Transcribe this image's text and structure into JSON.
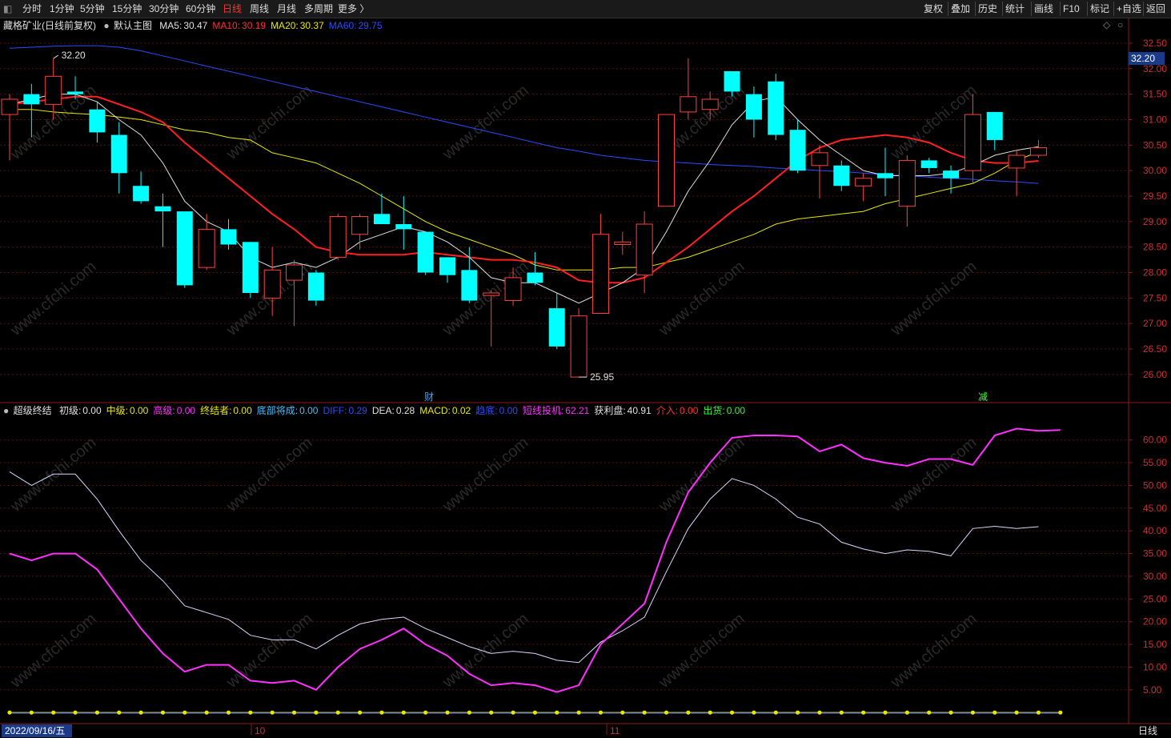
{
  "toolbar": {
    "periods": [
      "分时",
      "1分钟",
      "5分钟",
      "15分钟",
      "30分钟",
      "60分钟",
      "日线",
      "周线",
      "月线",
      "多周期",
      "更多 〉"
    ],
    "active_period": "日线",
    "right_buttons": [
      "复权",
      "叠加",
      "历史",
      "统计",
      "画线",
      "F10",
      "标记",
      "+自选",
      "返回"
    ]
  },
  "main_legend": {
    "name": "藏格矿业(日线前复权)",
    "indicator": "默认主图",
    "items": [
      {
        "label": "MA5:",
        "value": "30.47",
        "color": "#e0e0e0"
      },
      {
        "label": "MA10:",
        "value": "30.19",
        "color": "#ff3030"
      },
      {
        "label": "MA20:",
        "value": "30.37",
        "color": "#e8e800"
      },
      {
        "label": "MA60:",
        "value": "29.75",
        "color": "#2a4cff"
      }
    ]
  },
  "sub_legend": {
    "name": "超级终结",
    "items": [
      {
        "label": "初级:",
        "value": "0.00",
        "color": "#e0e0e0"
      },
      {
        "label": "中级:",
        "value": "0.00",
        "color": "#e8e800"
      },
      {
        "label": "高级:",
        "value": "0.00",
        "color": "#ff30ff"
      },
      {
        "label": "终结者:",
        "value": "0.00",
        "color": "#e8e800"
      },
      {
        "label": "底部将成:",
        "value": "0.00",
        "color": "#40c0ff"
      },
      {
        "label": "DIFF:",
        "value": "0.29",
        "color": "#2a4cff"
      },
      {
        "label": "DEA:",
        "value": "0.28",
        "color": "#e0e0e0"
      },
      {
        "label": "MACD:",
        "value": "0.02",
        "color": "#e8e800"
      },
      {
        "label": "趋底:",
        "value": "0.00",
        "color": "#2a4cff"
      },
      {
        "label": "短线投机:",
        "value": "62.21",
        "color": "#ff30ff"
      },
      {
        "label": "获利盘:",
        "value": "40.91",
        "color": "#e0e0e0"
      },
      {
        "label": "介入:",
        "value": "0.00",
        "color": "#ff3030"
      },
      {
        "label": "出货:",
        "value": "0.00",
        "color": "#30ff30"
      }
    ]
  },
  "price_axis": {
    "current_price": "32.20",
    "ticks": [
      "32.50",
      "32.00",
      "31.50",
      "31.00",
      "30.50",
      "30.00",
      "29.50",
      "29.00",
      "28.50",
      "28.00",
      "27.50",
      "27.00",
      "26.50",
      "26.00"
    ],
    "ymin": 25.7,
    "ymax": 32.75
  },
  "sub_axis": {
    "ticks": [
      "60.00",
      "55.00",
      "50.00",
      "45.00",
      "40.00",
      "35.00",
      "30.00",
      "25.00",
      "20.00",
      "15.00",
      "10.00",
      "5.00"
    ],
    "ymin": -0.5,
    "ymax": 64
  },
  "date_axis": {
    "labels": [
      "2022/09/16/五",
      "10",
      "11"
    ],
    "period": "日线"
  },
  "markers": {
    "high_label": "32.20",
    "low_label": "25.95",
    "event1": "财",
    "event2": "减"
  },
  "watermark": "www.cfchi.com",
  "chart_data": {
    "type": "candlestick",
    "series_candles": [
      {
        "o": 31.1,
        "h": 31.5,
        "l": 30.2,
        "c": 31.4
      },
      {
        "o": 31.5,
        "h": 31.7,
        "l": 30.65,
        "c": 31.3
      },
      {
        "o": 31.3,
        "h": 32.2,
        "l": 31.0,
        "c": 31.85
      },
      {
        "o": 31.55,
        "h": 31.85,
        "l": 31.4,
        "c": 31.5
      },
      {
        "o": 31.2,
        "h": 31.35,
        "l": 30.55,
        "c": 30.75
      },
      {
        "o": 30.7,
        "h": 30.95,
        "l": 29.55,
        "c": 29.95
      },
      {
        "o": 29.7,
        "h": 29.98,
        "l": 29.35,
        "c": 29.4
      },
      {
        "o": 29.3,
        "h": 29.55,
        "l": 28.5,
        "c": 29.2
      },
      {
        "o": 29.2,
        "h": 29.2,
        "l": 27.7,
        "c": 27.75
      },
      {
        "o": 28.1,
        "h": 29.15,
        "l": 28.05,
        "c": 28.85
      },
      {
        "o": 28.85,
        "h": 29.05,
        "l": 28.45,
        "c": 28.55
      },
      {
        "o": 28.6,
        "h": 28.6,
        "l": 27.5,
        "c": 27.6
      },
      {
        "o": 27.5,
        "h": 28.5,
        "l": 27.15,
        "c": 28.05
      },
      {
        "o": 27.85,
        "h": 28.25,
        "l": 26.95,
        "c": 28.15
      },
      {
        "o": 28.0,
        "h": 28.05,
        "l": 27.35,
        "c": 27.45
      },
      {
        "o": 28.3,
        "h": 29.15,
        "l": 28.25,
        "c": 29.1
      },
      {
        "o": 28.75,
        "h": 29.15,
        "l": 28.45,
        "c": 29.1
      },
      {
        "o": 29.15,
        "h": 29.55,
        "l": 28.95,
        "c": 28.95
      },
      {
        "o": 28.95,
        "h": 29.5,
        "l": 28.45,
        "c": 28.85
      },
      {
        "o": 28.8,
        "h": 28.8,
        "l": 27.95,
        "c": 28.0
      },
      {
        "o": 28.3,
        "h": 28.3,
        "l": 27.8,
        "c": 27.95
      },
      {
        "o": 28.05,
        "h": 28.5,
        "l": 27.4,
        "c": 27.45
      },
      {
        "o": 27.55,
        "h": 27.65,
        "l": 26.55,
        "c": 27.6
      },
      {
        "o": 27.45,
        "h": 28.1,
        "l": 27.35,
        "c": 27.9
      },
      {
        "o": 28.0,
        "h": 28.4,
        "l": 27.75,
        "c": 27.8
      },
      {
        "o": 27.3,
        "h": 27.6,
        "l": 26.5,
        "c": 26.55
      },
      {
        "o": 25.95,
        "h": 27.3,
        "l": 25.95,
        "c": 27.15
      },
      {
        "o": 27.2,
        "h": 29.15,
        "l": 27.2,
        "c": 28.75
      },
      {
        "o": 28.55,
        "h": 28.8,
        "l": 28.35,
        "c": 28.6
      },
      {
        "o": 27.95,
        "h": 29.2,
        "l": 27.6,
        "c": 28.95
      },
      {
        "o": 29.3,
        "h": 31.1,
        "l": 29.3,
        "c": 31.1
      },
      {
        "o": 31.15,
        "h": 32.2,
        "l": 31.0,
        "c": 31.45
      },
      {
        "o": 31.2,
        "h": 31.55,
        "l": 31.0,
        "c": 31.4
      },
      {
        "o": 31.95,
        "h": 31.95,
        "l": 31.45,
        "c": 31.55
      },
      {
        "o": 31.5,
        "h": 31.65,
        "l": 30.65,
        "c": 31.0
      },
      {
        "o": 31.75,
        "h": 31.9,
        "l": 30.6,
        "c": 30.7
      },
      {
        "o": 30.8,
        "h": 31.0,
        "l": 29.95,
        "c": 30.0
      },
      {
        "o": 30.1,
        "h": 30.5,
        "l": 29.45,
        "c": 30.35
      },
      {
        "o": 30.1,
        "h": 30.2,
        "l": 29.6,
        "c": 29.7
      },
      {
        "o": 29.7,
        "h": 29.95,
        "l": 29.4,
        "c": 29.85
      },
      {
        "o": 29.95,
        "h": 30.45,
        "l": 29.5,
        "c": 29.85
      },
      {
        "o": 29.3,
        "h": 30.3,
        "l": 28.9,
        "c": 30.2
      },
      {
        "o": 30.2,
        "h": 30.25,
        "l": 29.95,
        "c": 30.05
      },
      {
        "o": 30.0,
        "h": 30.1,
        "l": 29.55,
        "c": 29.85
      },
      {
        "o": 30.0,
        "h": 31.5,
        "l": 29.75,
        "c": 31.1
      },
      {
        "o": 31.15,
        "h": 31.15,
        "l": 30.4,
        "c": 30.6
      },
      {
        "o": 30.05,
        "h": 30.4,
        "l": 29.5,
        "c": 30.3
      },
      {
        "o": 30.3,
        "h": 30.6,
        "l": 30.25,
        "c": 30.45
      }
    ],
    "ma5": [
      31.3,
      31.4,
      31.5,
      31.5,
      31.35,
      31.0,
      30.7,
      30.15,
      29.4,
      29.0,
      28.8,
      28.3,
      28.1,
      28.2,
      28.1,
      28.3,
      28.6,
      28.75,
      28.9,
      28.8,
      28.6,
      28.3,
      27.9,
      27.8,
      27.8,
      27.6,
      27.4,
      27.6,
      27.8,
      28.1,
      28.8,
      29.6,
      30.2,
      30.9,
      31.35,
      31.45,
      31.0,
      30.6,
      30.3,
      30.0,
      29.9,
      29.9,
      29.9,
      29.95,
      30.1,
      30.3,
      30.4,
      30.47
    ],
    "ma10": [
      31.3,
      31.35,
      31.4,
      31.45,
      31.45,
      31.3,
      31.15,
      30.95,
      30.55,
      30.2,
      29.85,
      29.5,
      29.15,
      28.85,
      28.5,
      28.4,
      28.35,
      28.35,
      28.35,
      28.4,
      28.35,
      28.3,
      28.25,
      28.25,
      28.2,
      28.1,
      27.85,
      27.8,
      27.8,
      27.9,
      28.2,
      28.5,
      28.85,
      29.2,
      29.5,
      29.85,
      30.2,
      30.45,
      30.6,
      30.65,
      30.7,
      30.65,
      30.55,
      30.35,
      30.2,
      30.15,
      30.15,
      30.19
    ],
    "ma20": [
      31.2,
      31.2,
      31.15,
      31.12,
      31.1,
      31.05,
      31.0,
      30.9,
      30.8,
      30.75,
      30.65,
      30.6,
      30.35,
      30.25,
      30.15,
      29.95,
      29.75,
      29.5,
      29.25,
      29.0,
      28.8,
      28.65,
      28.5,
      28.35,
      28.15,
      28.05,
      28.05,
      28.05,
      28.1,
      28.1,
      28.2,
      28.3,
      28.45,
      28.6,
      28.75,
      28.95,
      29.05,
      29.1,
      29.15,
      29.2,
      29.35,
      29.45,
      29.55,
      29.65,
      29.75,
      29.95,
      30.2,
      30.37
    ],
    "ma60": [
      32.4,
      32.42,
      32.44,
      32.45,
      32.45,
      32.42,
      32.35,
      32.25,
      32.15,
      32.05,
      31.95,
      31.85,
      31.75,
      31.65,
      31.55,
      31.45,
      31.35,
      31.25,
      31.15,
      31.05,
      30.95,
      30.85,
      30.75,
      30.65,
      30.55,
      30.45,
      30.38,
      30.3,
      30.25,
      30.2,
      30.17,
      30.15,
      30.12,
      30.1,
      30.08,
      30.05,
      30.03,
      30.0,
      29.98,
      29.95,
      29.92,
      29.9,
      29.87,
      29.85,
      29.83,
      29.8,
      29.78,
      29.75
    ],
    "short_spec": [
      35,
      33.5,
      35,
      35,
      31.5,
      25,
      18.5,
      13,
      9,
      10.5,
      10.5,
      7,
      6.5,
      7,
      5,
      10,
      14,
      16,
      18.5,
      15,
      12.5,
      8.5,
      6,
      6.5,
      6,
      4.5,
      6,
      15,
      19.5,
      24,
      37.5,
      48.5,
      55,
      60.5,
      61,
      61,
      60.8,
      57.5,
      59,
      56,
      55,
      54.3,
      55.8,
      55.8,
      54.5,
      61,
      62.5,
      62,
      62.21
    ],
    "profit": [
      53,
      50,
      52.5,
      52.5,
      47,
      40,
      33.5,
      29,
      23.5,
      22,
      20.5,
      17,
      16,
      16,
      14,
      17,
      19.5,
      20.5,
      21,
      18.5,
      16.5,
      14.5,
      13,
      13.5,
      13,
      11.5,
      11,
      15.5,
      18,
      21,
      31,
      40.5,
      47,
      51.5,
      50,
      47,
      43,
      41.5,
      37.5,
      36,
      35,
      35.8,
      35.5,
      34.5,
      40.5,
      41,
      40.5,
      40.91
    ]
  }
}
